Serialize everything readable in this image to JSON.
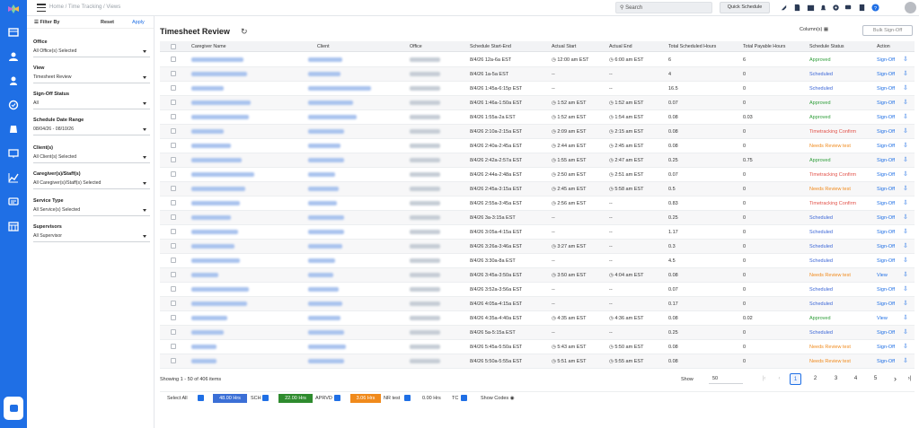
{
  "app": {
    "brand_colors": {
      "primary": "#1f6fe5"
    }
  },
  "breadcrumb": "Home / Time Tracking / Views",
  "search": {
    "placeholder": "Search"
  },
  "quick_schedule_label": "Quick Schedule",
  "filters": {
    "title": "Filter By",
    "reset": "Reset",
    "apply": "Apply",
    "groups": [
      {
        "label": "Office",
        "value": "All Office(s) Selected"
      },
      {
        "label": "View",
        "value": "Timesheet Review"
      },
      {
        "label": "Sign-Off Status",
        "value": "All"
      },
      {
        "label": "Schedule Date Range",
        "value": "08/04/26 - 08/10/26"
      },
      {
        "label": "Client(s)",
        "value": "All Client(s) Selected"
      },
      {
        "label": "Caregiver(s)/Staff(s)",
        "value": "All Caregiver(s)/Staff(s) Selected"
      },
      {
        "label": "Service Type",
        "value": "All Service(s) Selected"
      },
      {
        "label": "Supervisors",
        "value": "All Supervisor"
      }
    ]
  },
  "page": {
    "title": "Timesheet Review",
    "columns_label": "Column(s)",
    "bulk_label": "Bulk Sign-Off"
  },
  "table": {
    "headers": [
      "Caregiver Name",
      "Client",
      "Office",
      "Schedule Start-End",
      "Actual Start",
      "Actual End",
      "Total Scheduled Hours",
      "Total Payable Hours",
      "Schedule Status",
      "Action"
    ],
    "rows": [
      {
        "sched": "8/4/26 12a-6a EST",
        "astart": "12:00 am EST",
        "aend": "6:00 am EST",
        "tsh": "6",
        "tph": "6",
        "status": "Approved",
        "stype": "approved",
        "action": "Sign-Off"
      },
      {
        "sched": "8/4/26 1a-5a EST",
        "astart": "--",
        "aend": "--",
        "tsh": "4",
        "tph": "0",
        "status": "Scheduled",
        "stype": "scheduled",
        "action": "Sign-Off"
      },
      {
        "sched": "8/4/26 1:45a-6:15p EST",
        "astart": "--",
        "aend": "--",
        "tsh": "16.5",
        "tph": "0",
        "status": "Scheduled",
        "stype": "scheduled",
        "action": "Sign-Off"
      },
      {
        "sched": "8/4/26 1:46a-1:50a EST",
        "astart": "1:52 am EST",
        "aend": "1:52 am EST",
        "tsh": "0.07",
        "tph": "0",
        "status": "Approved",
        "stype": "approved",
        "action": "Sign-Off"
      },
      {
        "sched": "8/4/26 1:55a-2a EST",
        "astart": "1:52 am EST",
        "aend": "1:54 am EST",
        "tsh": "0.08",
        "tph": "0.03",
        "status": "Approved",
        "stype": "approved",
        "action": "Sign-Off"
      },
      {
        "sched": "8/4/26 2:10a-2:15a EST",
        "astart": "2:09 am EST",
        "aend": "2:15 am EST",
        "tsh": "0.08",
        "tph": "0",
        "status": "Timetracking Confirm",
        "stype": "confirm",
        "action": "Sign-Off"
      },
      {
        "sched": "8/4/26 2:40a-2:45a EST",
        "astart": "2:44 am EST",
        "aend": "2:45 am EST",
        "tsh": "0.08",
        "tph": "0",
        "status": "Needs Review test",
        "stype": "review",
        "action": "Sign-Off"
      },
      {
        "sched": "8/4/26 2:42a-2:57a EST",
        "astart": "1:55 am EST",
        "aend": "2:47 am EST",
        "tsh": "0.25",
        "tph": "0.75",
        "status": "Approved",
        "stype": "approved",
        "action": "Sign-Off"
      },
      {
        "sched": "8/4/26 2:44a-2:48a EST",
        "astart": "2:50 am EST",
        "aend": "2:51 am EST",
        "tsh": "0.07",
        "tph": "0",
        "status": "Timetracking Confirm",
        "stype": "confirm",
        "action": "Sign-Off"
      },
      {
        "sched": "8/4/26 2:45a-3:15a EST",
        "astart": "2:45 am EST",
        "aend": "5:58 am EST",
        "tsh": "0.5",
        "tph": "0",
        "status": "Needs Review test",
        "stype": "review",
        "action": "Sign-Off"
      },
      {
        "sched": "8/4/26 2:55a-3:45a EST",
        "astart": "2:56 am EST",
        "aend": "--",
        "tsh": "0.83",
        "tph": "0",
        "status": "Timetracking Confirm",
        "stype": "confirm",
        "action": "Sign-Off"
      },
      {
        "sched": "8/4/26 3a-3:15a EST",
        "astart": "--",
        "aend": "--",
        "tsh": "0.25",
        "tph": "0",
        "status": "Scheduled",
        "stype": "scheduled",
        "action": "Sign-Off"
      },
      {
        "sched": "8/4/26 3:05a-4:15a EST",
        "astart": "--",
        "aend": "--",
        "tsh": "1.17",
        "tph": "0",
        "status": "Scheduled",
        "stype": "scheduled",
        "action": "Sign-Off"
      },
      {
        "sched": "8/4/26 3:26a-3:46a EST",
        "astart": "3:27 am EST",
        "aend": "--",
        "tsh": "0.3",
        "tph": "0",
        "status": "Scheduled",
        "stype": "scheduled",
        "action": "Sign-Off"
      },
      {
        "sched": "8/4/26 3:30a-8a EST",
        "astart": "--",
        "aend": "--",
        "tsh": "4.5",
        "tph": "0",
        "status": "Scheduled",
        "stype": "scheduled",
        "action": "Sign-Off"
      },
      {
        "sched": "8/4/26 3:45a-3:50a EST",
        "astart": "3:50 am EST",
        "aend": "4:04 am EST",
        "tsh": "0.08",
        "tph": "0",
        "status": "Needs Review test",
        "stype": "review",
        "action": "View"
      },
      {
        "sched": "8/4/26 3:52a-3:56a EST",
        "astart": "--",
        "aend": "--",
        "tsh": "0.07",
        "tph": "0",
        "status": "Scheduled",
        "stype": "scheduled",
        "action": "Sign-Off"
      },
      {
        "sched": "8/4/26 4:05a-4:15a EST",
        "astart": "--",
        "aend": "--",
        "tsh": "0.17",
        "tph": "0",
        "status": "Scheduled",
        "stype": "scheduled",
        "action": "Sign-Off"
      },
      {
        "sched": "8/4/26 4:35a-4:40a EST",
        "astart": "4:35 am EST",
        "aend": "4:36 am EST",
        "tsh": "0.08",
        "tph": "0.02",
        "status": "Approved",
        "stype": "approved",
        "action": "View"
      },
      {
        "sched": "8/4/26 5a-5:15a EST",
        "astart": "--",
        "aend": "--",
        "tsh": "0.25",
        "tph": "0",
        "status": "Scheduled",
        "stype": "scheduled",
        "action": "Sign-Off"
      },
      {
        "sched": "8/4/26 5:45a-5:50a EST",
        "astart": "5:43 am EST",
        "aend": "5:50 am EST",
        "tsh": "0.08",
        "tph": "0",
        "status": "Needs Review test",
        "stype": "review",
        "action": "Sign-Off"
      },
      {
        "sched": "8/4/26 5:50a-5:55a EST",
        "astart": "5:51 am EST",
        "aend": "5:55 am EST",
        "tsh": "0.08",
        "tph": "0",
        "status": "Needs Review test",
        "stype": "review",
        "action": "Sign-Off"
      }
    ]
  },
  "pagination": {
    "showing": "Showing 1 - 50 of 406 items",
    "show_label": "Show",
    "page_size": "50",
    "pages": [
      "1",
      "2",
      "3",
      "4",
      "5"
    ],
    "current": "1"
  },
  "legend": {
    "select_all": "Select All",
    "items": [
      {
        "label": "48.00 Hrs",
        "color": "#3b6fd6"
      },
      {
        "label": "SCH"
      },
      {
        "label": "22.00 Hrs",
        "color": "#2e8b2e"
      },
      {
        "label": "APRVD"
      },
      {
        "label": "3.06 Hrs",
        "color": "#f08a1c"
      },
      {
        "label": "NR test"
      },
      {
        "label": "0.00 Hrs"
      },
      {
        "label": "TC"
      }
    ],
    "show_codes": "Show Codes"
  }
}
